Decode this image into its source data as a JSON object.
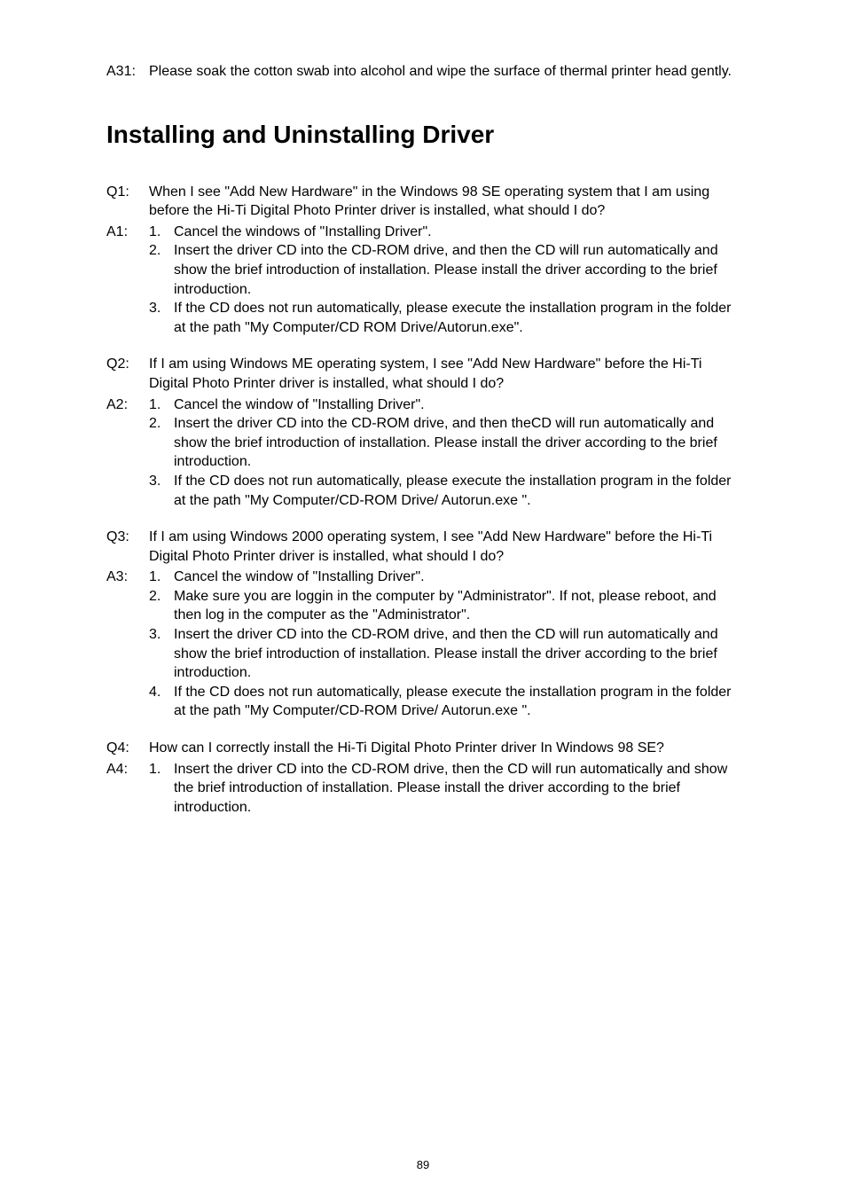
{
  "a31": {
    "label": "A31:",
    "text": "Please soak the cotton swab into alcohol and wipe the surface of thermal printer head gently."
  },
  "heading": "Installing and Uninstalling Driver",
  "q1": {
    "label": "Q1:",
    "text": "When I see \"Add New Hardware\" in the Windows 98 SE operating system that I am using before the Hi-Ti Digital Photo Printer driver is installed, what should I do?"
  },
  "a1": {
    "label": "A1:",
    "items": [
      {
        "num": "1.",
        "text": "Cancel the windows of \"Installing Driver\"."
      },
      {
        "num": "2.",
        "text": "Insert the driver CD into the CD-ROM drive, and then the CD will run automatically and show the brief introduction of installation.    Please install the driver according to the brief introduction."
      },
      {
        "num": "3.",
        "text": "If the CD does not run automatically, please execute the installation program in the folder at the path \"My Computer/CD ROM Drive/Autorun.exe\"."
      }
    ]
  },
  "q2": {
    "label": "Q2:",
    "text": "If I am using Windows ME operating system, I see \"Add New Hardware\" before the Hi-Ti Digital Photo Printer driver is installed, what should I do?"
  },
  "a2": {
    "label": "A2:",
    "items": [
      {
        "num": "1.",
        "text": "Cancel the window of \"Installing Driver\"."
      },
      {
        "num": "2.",
        "text": "Insert the driver CD into the CD-ROM drive, and then theCD will run automatically and show the brief introduction of installation.    Please install the driver according to the brief introduction."
      },
      {
        "num": "3.",
        "text": "If the CD does not run automatically, please execute the installation program in the folder at the path \"My Computer/CD-ROM Drive/ Autorun.exe \"."
      }
    ]
  },
  "q3": {
    "label": "Q3:",
    "text": "If I am using Windows 2000 operating system, I see \"Add New Hardware\" before the Hi-Ti Digital Photo Printer driver is installed, what should I do?"
  },
  "a3": {
    "label": "A3:",
    "items": [
      {
        "num": "1.",
        "text": "Cancel the window of \"Installing Driver\"."
      },
      {
        "num": "2.",
        "text": "Make sure you are loggin in the computer by \"Administrator\".    If not, please reboot, and then log in the computer as the \"Administrator\"."
      },
      {
        "num": "3.",
        "text": "Insert the driver CD into the CD-ROM drive, and then the CD will run automatically and show the brief introduction of installation.    Please install the driver according to the brief introduction."
      },
      {
        "num": "4.",
        "text": "If the CD does not run automatically, please execute the installation program in the folder at the path \"My Computer/CD-ROM Drive/ Autorun.exe \"."
      }
    ]
  },
  "q4": {
    "label": "Q4:",
    "text": "How can I correctly install the Hi-Ti Digital Photo Printer driver In Windows 98 SE?"
  },
  "a4": {
    "label": "A4:",
    "items": [
      {
        "num": "1.",
        "text": "Insert the driver CD into the CD-ROM drive, then the CD will run automatically and show the brief introduction of installation.    Please install the driver according to the brief introduction."
      }
    ]
  },
  "pageNumber": "89"
}
